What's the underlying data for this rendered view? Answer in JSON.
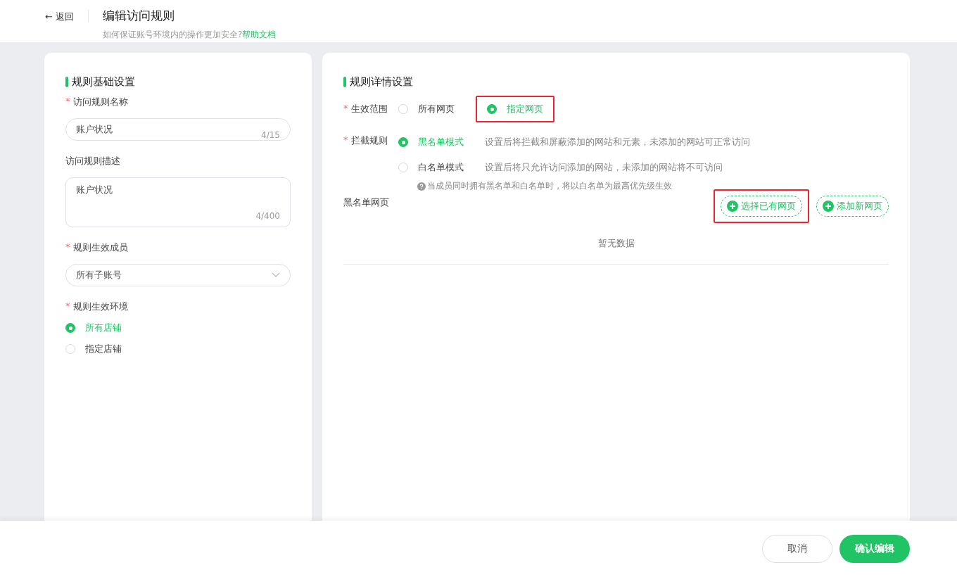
{
  "header": {
    "back": "← 返回",
    "title": "编辑访问规则",
    "hint": "如何保证账号环境内的操作更加安全?",
    "help_link": "帮助文档"
  },
  "basic": {
    "title": "规则基础设置",
    "name_field": {
      "label": "访问规则名称",
      "required_mark": "*",
      "value": "账户状况",
      "counter": "4/15"
    },
    "desc_field": {
      "label": "访问规则描述",
      "value": "账户状况",
      "counter": "4/400"
    },
    "members_field": {
      "label": "规则生效成员",
      "required_mark": "*",
      "value": "所有子账号"
    },
    "env": {
      "label": "规则生效环境",
      "required_mark": "*",
      "options": [
        {
          "label": "所有店铺",
          "selected": true
        },
        {
          "label": "指定店铺",
          "selected": false
        }
      ]
    }
  },
  "detail": {
    "title": "规则详情设置",
    "scope": {
      "label": "生效范围",
      "required_mark": "*",
      "options": [
        {
          "label": "所有网页",
          "selected": false,
          "highlighted": false
        },
        {
          "label": "指定网页",
          "selected": true,
          "highlighted": true
        }
      ]
    },
    "block": {
      "label": "拦截规则",
      "required_mark": "*",
      "options": [
        {
          "label": "黑名单模式",
          "selected": true,
          "description": "设置后将拦截和屏蔽添加的网站和元素，未添加的网站可正常访问"
        },
        {
          "label": "白名单模式",
          "selected": false,
          "description": "设置后将只允许访问添加的网站，未添加的网站将不可访问"
        }
      ],
      "note": "当成员同时拥有黑名单和白名单时，将以白名单为最高优先级生效"
    },
    "list": {
      "label": "黑名单网页",
      "buttons": [
        {
          "label": "选择已有网页",
          "highlighted": true
        },
        {
          "label": "添加新网页",
          "highlighted": false
        }
      ],
      "empty": "暂无数据"
    }
  },
  "footer": {
    "buttons": [
      {
        "label": "取消",
        "kind": "secondary"
      },
      {
        "label": "确认编辑",
        "kind": "primary"
      }
    ]
  }
}
